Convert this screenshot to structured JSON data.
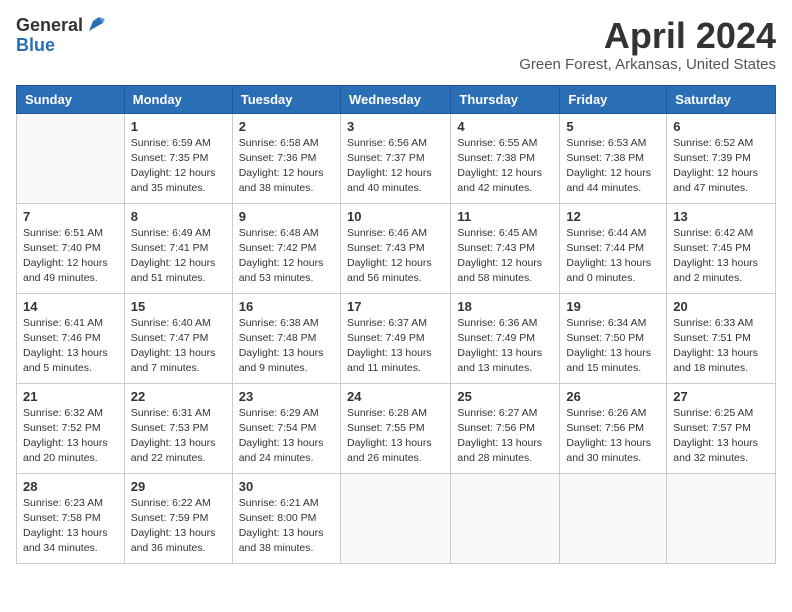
{
  "logo": {
    "general": "General",
    "blue": "Blue"
  },
  "title": "April 2024",
  "subtitle": "Green Forest, Arkansas, United States",
  "days_of_week": [
    "Sunday",
    "Monday",
    "Tuesday",
    "Wednesday",
    "Thursday",
    "Friday",
    "Saturday"
  ],
  "weeks": [
    [
      {
        "day": null,
        "info": null
      },
      {
        "day": "1",
        "sunrise": "Sunrise: 6:59 AM",
        "sunset": "Sunset: 7:35 PM",
        "daylight": "Daylight: 12 hours and 35 minutes."
      },
      {
        "day": "2",
        "sunrise": "Sunrise: 6:58 AM",
        "sunset": "Sunset: 7:36 PM",
        "daylight": "Daylight: 12 hours and 38 minutes."
      },
      {
        "day": "3",
        "sunrise": "Sunrise: 6:56 AM",
        "sunset": "Sunset: 7:37 PM",
        "daylight": "Daylight: 12 hours and 40 minutes."
      },
      {
        "day": "4",
        "sunrise": "Sunrise: 6:55 AM",
        "sunset": "Sunset: 7:38 PM",
        "daylight": "Daylight: 12 hours and 42 minutes."
      },
      {
        "day": "5",
        "sunrise": "Sunrise: 6:53 AM",
        "sunset": "Sunset: 7:38 PM",
        "daylight": "Daylight: 12 hours and 44 minutes."
      },
      {
        "day": "6",
        "sunrise": "Sunrise: 6:52 AM",
        "sunset": "Sunset: 7:39 PM",
        "daylight": "Daylight: 12 hours and 47 minutes."
      }
    ],
    [
      {
        "day": "7",
        "sunrise": "Sunrise: 6:51 AM",
        "sunset": "Sunset: 7:40 PM",
        "daylight": "Daylight: 12 hours and 49 minutes."
      },
      {
        "day": "8",
        "sunrise": "Sunrise: 6:49 AM",
        "sunset": "Sunset: 7:41 PM",
        "daylight": "Daylight: 12 hours and 51 minutes."
      },
      {
        "day": "9",
        "sunrise": "Sunrise: 6:48 AM",
        "sunset": "Sunset: 7:42 PM",
        "daylight": "Daylight: 12 hours and 53 minutes."
      },
      {
        "day": "10",
        "sunrise": "Sunrise: 6:46 AM",
        "sunset": "Sunset: 7:43 PM",
        "daylight": "Daylight: 12 hours and 56 minutes."
      },
      {
        "day": "11",
        "sunrise": "Sunrise: 6:45 AM",
        "sunset": "Sunset: 7:43 PM",
        "daylight": "Daylight: 12 hours and 58 minutes."
      },
      {
        "day": "12",
        "sunrise": "Sunrise: 6:44 AM",
        "sunset": "Sunset: 7:44 PM",
        "daylight": "Daylight: 13 hours and 0 minutes."
      },
      {
        "day": "13",
        "sunrise": "Sunrise: 6:42 AM",
        "sunset": "Sunset: 7:45 PM",
        "daylight": "Daylight: 13 hours and 2 minutes."
      }
    ],
    [
      {
        "day": "14",
        "sunrise": "Sunrise: 6:41 AM",
        "sunset": "Sunset: 7:46 PM",
        "daylight": "Daylight: 13 hours and 5 minutes."
      },
      {
        "day": "15",
        "sunrise": "Sunrise: 6:40 AM",
        "sunset": "Sunset: 7:47 PM",
        "daylight": "Daylight: 13 hours and 7 minutes."
      },
      {
        "day": "16",
        "sunrise": "Sunrise: 6:38 AM",
        "sunset": "Sunset: 7:48 PM",
        "daylight": "Daylight: 13 hours and 9 minutes."
      },
      {
        "day": "17",
        "sunrise": "Sunrise: 6:37 AM",
        "sunset": "Sunset: 7:49 PM",
        "daylight": "Daylight: 13 hours and 11 minutes."
      },
      {
        "day": "18",
        "sunrise": "Sunrise: 6:36 AM",
        "sunset": "Sunset: 7:49 PM",
        "daylight": "Daylight: 13 hours and 13 minutes."
      },
      {
        "day": "19",
        "sunrise": "Sunrise: 6:34 AM",
        "sunset": "Sunset: 7:50 PM",
        "daylight": "Daylight: 13 hours and 15 minutes."
      },
      {
        "day": "20",
        "sunrise": "Sunrise: 6:33 AM",
        "sunset": "Sunset: 7:51 PM",
        "daylight": "Daylight: 13 hours and 18 minutes."
      }
    ],
    [
      {
        "day": "21",
        "sunrise": "Sunrise: 6:32 AM",
        "sunset": "Sunset: 7:52 PM",
        "daylight": "Daylight: 13 hours and 20 minutes."
      },
      {
        "day": "22",
        "sunrise": "Sunrise: 6:31 AM",
        "sunset": "Sunset: 7:53 PM",
        "daylight": "Daylight: 13 hours and 22 minutes."
      },
      {
        "day": "23",
        "sunrise": "Sunrise: 6:29 AM",
        "sunset": "Sunset: 7:54 PM",
        "daylight": "Daylight: 13 hours and 24 minutes."
      },
      {
        "day": "24",
        "sunrise": "Sunrise: 6:28 AM",
        "sunset": "Sunset: 7:55 PM",
        "daylight": "Daylight: 13 hours and 26 minutes."
      },
      {
        "day": "25",
        "sunrise": "Sunrise: 6:27 AM",
        "sunset": "Sunset: 7:56 PM",
        "daylight": "Daylight: 13 hours and 28 minutes."
      },
      {
        "day": "26",
        "sunrise": "Sunrise: 6:26 AM",
        "sunset": "Sunset: 7:56 PM",
        "daylight": "Daylight: 13 hours and 30 minutes."
      },
      {
        "day": "27",
        "sunrise": "Sunrise: 6:25 AM",
        "sunset": "Sunset: 7:57 PM",
        "daylight": "Daylight: 13 hours and 32 minutes."
      }
    ],
    [
      {
        "day": "28",
        "sunrise": "Sunrise: 6:23 AM",
        "sunset": "Sunset: 7:58 PM",
        "daylight": "Daylight: 13 hours and 34 minutes."
      },
      {
        "day": "29",
        "sunrise": "Sunrise: 6:22 AM",
        "sunset": "Sunset: 7:59 PM",
        "daylight": "Daylight: 13 hours and 36 minutes."
      },
      {
        "day": "30",
        "sunrise": "Sunrise: 6:21 AM",
        "sunset": "Sunset: 8:00 PM",
        "daylight": "Daylight: 13 hours and 38 minutes."
      },
      {
        "day": null,
        "info": null
      },
      {
        "day": null,
        "info": null
      },
      {
        "day": null,
        "info": null
      },
      {
        "day": null,
        "info": null
      }
    ]
  ]
}
